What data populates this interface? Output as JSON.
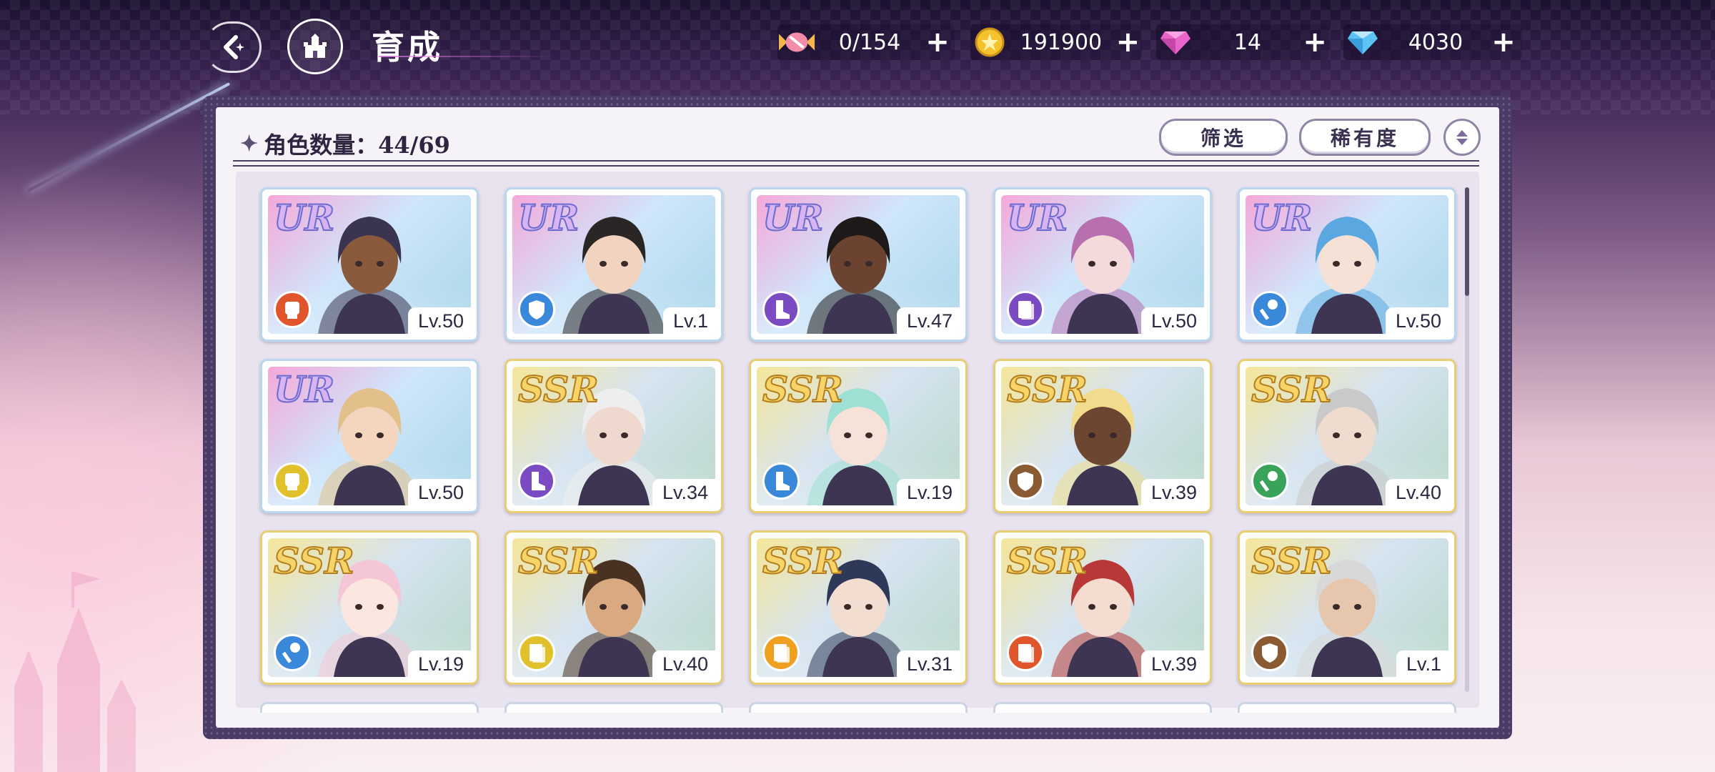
{
  "header": {
    "title": "育成",
    "back_icon": "back-arrow-icon",
    "home_icon": "castle-icon"
  },
  "currencies": [
    {
      "id": "candy",
      "icon": "candy-icon",
      "value": "0/154",
      "color": "#f0a040"
    },
    {
      "id": "gold",
      "icon": "gold-coin-icon",
      "value": "191900",
      "color": "#f3c22c"
    },
    {
      "id": "gem-pink",
      "icon": "pink-gem-icon",
      "value": "14",
      "color": "#e45bc8"
    },
    {
      "id": "gem-blue",
      "icon": "blue-diamond-icon",
      "value": "4030",
      "color": "#4fb6f2"
    }
  ],
  "plus_label": "+",
  "panel": {
    "count_label": "角色数量：44/69",
    "filter_label": "筛选",
    "rarity_label": "稀有度"
  },
  "cards": [
    {
      "rarity": "UR",
      "level": "Lv.50",
      "class": "fist-icon",
      "class_color": "#e0552b",
      "hair": "#3a3450",
      "skin": "#8a5a3c"
    },
    {
      "rarity": "UR",
      "level": "Lv.1",
      "class": "shield-icon",
      "class_color": "#3a88d9",
      "hair": "#2b2626",
      "skin": "#f1d3c0"
    },
    {
      "rarity": "UR",
      "level": "Lv.47",
      "class": "boot-icon",
      "class_color": "#7b4bc3",
      "hair": "#1e1a1a",
      "skin": "#6b4330"
    },
    {
      "rarity": "UR",
      "level": "Lv.50",
      "class": "book-icon",
      "class_color": "#7b4bc3",
      "hair": "#b86fb0",
      "skin": "#f4dadb"
    },
    {
      "rarity": "UR",
      "level": "Lv.50",
      "class": "staff-icon",
      "class_color": "#3a88d9",
      "hair": "#5ba7e0",
      "skin": "#f5e1d6"
    },
    {
      "rarity": "UR",
      "level": "Lv.50",
      "class": "fist-icon",
      "class_color": "#e0c12b",
      "hair": "#e3c08a",
      "skin": "#f3d6bd"
    },
    {
      "rarity": "SSR",
      "level": "Lv.34",
      "class": "boot-icon",
      "class_color": "#7b4bc3",
      "hair": "#eeeeee",
      "skin": "#efd9cf"
    },
    {
      "rarity": "SSR",
      "level": "Lv.19",
      "class": "boot-icon",
      "class_color": "#3a88d9",
      "hair": "#9fe0d4",
      "skin": "#f6e2d8"
    },
    {
      "rarity": "SSR",
      "level": "Lv.39",
      "class": "shield-icon",
      "class_color": "#8a5a32",
      "hair": "#f0dc8c",
      "skin": "#6d4632"
    },
    {
      "rarity": "SSR",
      "level": "Lv.40",
      "class": "staff-icon",
      "class_color": "#3aa35a",
      "hair": "#c9c9c9",
      "skin": "#f0dccf"
    },
    {
      "rarity": "SSR",
      "level": "Lv.19",
      "class": "staff-icon",
      "class_color": "#3a88d9",
      "hair": "#f4c6d6",
      "skin": "#fbe6e0"
    },
    {
      "rarity": "SSR",
      "level": "Lv.40",
      "class": "book-icon",
      "class_color": "#e0c12b",
      "hair": "#4a3222",
      "skin": "#d9a982"
    },
    {
      "rarity": "SSR",
      "level": "Lv.31",
      "class": "book-icon",
      "class_color": "#f0a020",
      "hair": "#2e3858",
      "skin": "#f2ddd0"
    },
    {
      "rarity": "SSR",
      "level": "Lv.39",
      "class": "book-icon",
      "class_color": "#e0552b",
      "hair": "#b83838",
      "skin": "#f4dcd0"
    },
    {
      "rarity": "SSR",
      "level": "Lv.1",
      "class": "shield-icon",
      "class_color": "#8a5a32",
      "hair": "#d8d8d8",
      "skin": "#e6c7ad"
    }
  ]
}
